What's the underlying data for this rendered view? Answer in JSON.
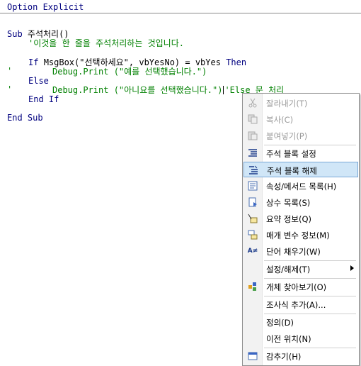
{
  "editor": {
    "header": "Option Explicit",
    "lines": {
      "l1_kw": "Sub ",
      "l1_txt": "주석처리()",
      "l2": "'이것을 한 줄을 주석처리하는 것입니다.",
      "l3_kw1": "If ",
      "l3_txt": "MsgBox(\"선택하세요\", vbYesNo) = vbYes ",
      "l3_kw2": "Then",
      "l4_mark": "'",
      "l4": "Debug.Print (\"예를 선택했습니다.\")",
      "l5": "Else",
      "l6_mark": "'",
      "l6": "Debug.Print (\"아니요를 선택했습니다.\")",
      "l6_tail": "'Else 문 처리",
      "l7": "End If",
      "l8": "End Sub"
    }
  },
  "context_menu": {
    "items": [
      {
        "label": "잘라내기(T)",
        "icon": "cut-icon"
      },
      {
        "label": "복사(C)",
        "icon": "copy-icon"
      },
      {
        "label": "붙여넣기(P)",
        "icon": "paste-icon"
      },
      {
        "label": "주석 블록 설정",
        "icon": "comment-block-icon"
      },
      {
        "label": "주석 블록 해제",
        "icon": "uncomment-block-icon"
      },
      {
        "label": "속성/메서드 목록(H)",
        "icon": "list-members-icon"
      },
      {
        "label": "상수 목록(S)",
        "icon": "list-constants-icon"
      },
      {
        "label": "요약 정보(Q)",
        "icon": "quick-info-icon"
      },
      {
        "label": "매개 변수 정보(M)",
        "icon": "parameter-info-icon"
      },
      {
        "label": "단어 채우기(W)",
        "icon": "complete-word-icon"
      },
      {
        "label": "설정/해제(T)",
        "icon": ""
      },
      {
        "label": "개체 찾아보기(O)",
        "icon": "object-browser-icon"
      },
      {
        "label": "조사식 추가(A)...",
        "icon": ""
      },
      {
        "label": "정의(D)",
        "icon": ""
      },
      {
        "label": "이전 위치(N)",
        "icon": ""
      },
      {
        "label": "감추기(H)",
        "icon": "hide-icon"
      }
    ]
  }
}
